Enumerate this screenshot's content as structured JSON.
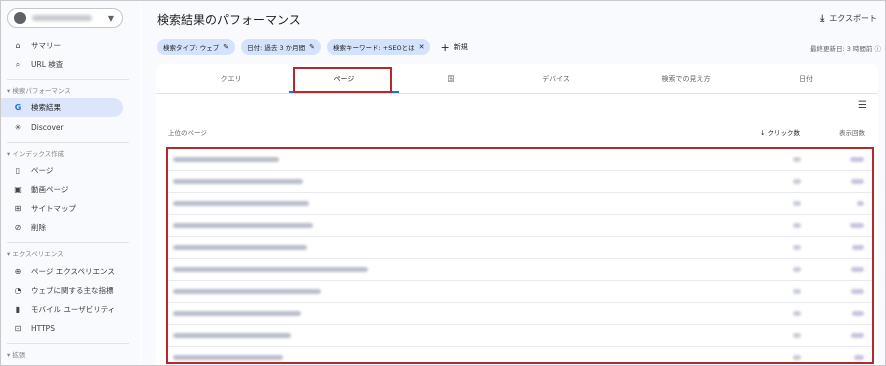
{
  "sidebar": {
    "nav_top": [
      {
        "label": "サマリー",
        "icon": "home-icon"
      },
      {
        "label": "URL 検査",
        "icon": "search-icon"
      }
    ],
    "section_performance": "検索パフォーマンス",
    "nav_performance": [
      {
        "label": "検索結果",
        "icon": "google-g-icon"
      },
      {
        "label": "Discover",
        "icon": "discover-asterisk-icon"
      }
    ],
    "section_index": "インデックス作成",
    "nav_index": [
      {
        "label": "ページ",
        "icon": "page-icon"
      },
      {
        "label": "動画ページ",
        "icon": "video-page-icon"
      },
      {
        "label": "サイトマップ",
        "icon": "sitemap-icon"
      },
      {
        "label": "削除",
        "icon": "removal-icon"
      }
    ],
    "section_experience": "エクスペリエンス",
    "nav_experience": [
      {
        "label": "ページ エクスペリエンス",
        "icon": "page-experience-icon"
      },
      {
        "label": "ウェブに関する主な指標",
        "icon": "core-web-vitals-icon"
      },
      {
        "label": "モバイル ユーザビリティ",
        "icon": "mobile-icon"
      },
      {
        "label": "HTTPS",
        "icon": "lock-icon"
      }
    ],
    "section_enhancements": "拡張"
  },
  "header": {
    "title": "検索結果のパフォーマンス",
    "export_label": "エクスポート",
    "last_updated": "最終更新日: 3 時間前"
  },
  "filters": {
    "chips": [
      "検索タイプ: ウェブ",
      "日付: 過去 3 か月間",
      "検索キーワード: +SEOとは"
    ],
    "new_label": "新規"
  },
  "tabs": [
    "クエリ",
    "ページ",
    "国",
    "デバイス",
    "検索での見え方",
    "日付"
  ],
  "active_tab": "ページ",
  "table": {
    "col_page": "上位のページ",
    "col_clicks": "クリック数",
    "col_impressions": "表示回数"
  },
  "colors": {
    "accent": "#1a73e8",
    "highlight_border": "#b7282e",
    "active_nav_bg": "#dbe6fb",
    "chip_bg": "#d3e3fd"
  }
}
